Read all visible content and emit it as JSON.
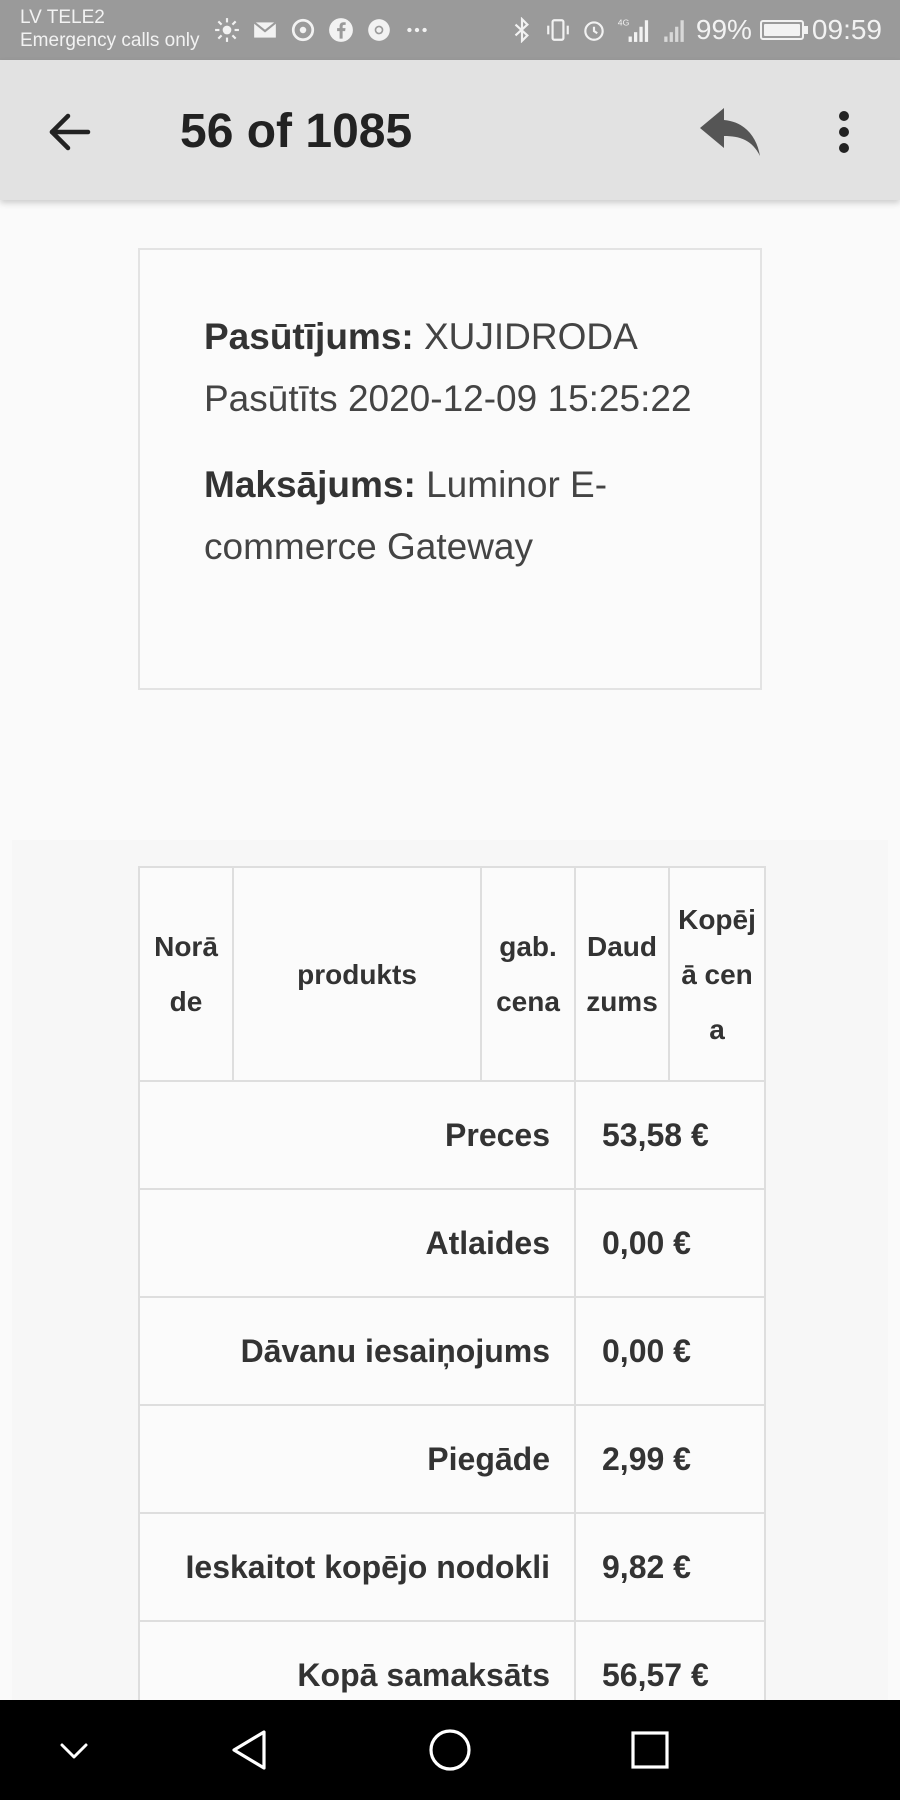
{
  "status_bar": {
    "carrier": "LV TELE2",
    "carrier_sub": "Emergency calls only",
    "network_label": "4G",
    "battery_percent": "99%",
    "battery_level": 0.99,
    "time": "09:59",
    "left_icons": [
      "sun-icon",
      "mail-icon",
      "app-icon",
      "facebook-icon",
      "chrome-icon",
      "more-dots-icon"
    ],
    "right_icons": [
      "bluetooth-icon",
      "vibrate-icon",
      "alarm-icon",
      "signal-icon",
      "signal-icon-2",
      "battery-icon"
    ]
  },
  "app_bar": {
    "title": "56 of 1085",
    "back_icon": "back-arrow-icon",
    "reply_icon": "reply-icon",
    "more_icon": "more-vert-icon"
  },
  "order_info": {
    "order_label": "Pasūtījums:",
    "order_value": "XUJIDRODA",
    "ordered_text": "Pasūtīts 2020-12-09 15:25:22",
    "payment_label": "Maksājums:",
    "payment_value": "Luminor E-commerce Gateway"
  },
  "order_table": {
    "headers": [
      "Norāde",
      "produkts",
      "gab. cena",
      "Daudzums",
      "Kopējā cena"
    ],
    "rows": [
      {
        "label": "Preces",
        "value": "53,58 €"
      },
      {
        "label": "Atlaides",
        "value": "0,00 €"
      },
      {
        "label": "Dāvanu iesaiņojums",
        "value": "0,00 €"
      },
      {
        "label": "Piegāde",
        "value": "2,99 €"
      },
      {
        "label": "Ieskaitot kopējo nodokli",
        "value": "9,82 €"
      },
      {
        "label": "Kopā samaksāts",
        "value": "56,57 €"
      }
    ]
  },
  "colors": {
    "status_bar_bg": "#9a9a9a",
    "app_bar_bg": "#e2e2e2",
    "page_bg": "#fafafa",
    "nav_bar_bg": "#000000"
  },
  "nav_bar": {
    "icons": [
      "collapse-icon",
      "back-triangle-icon",
      "home-circle-icon",
      "recents-square-icon"
    ]
  }
}
